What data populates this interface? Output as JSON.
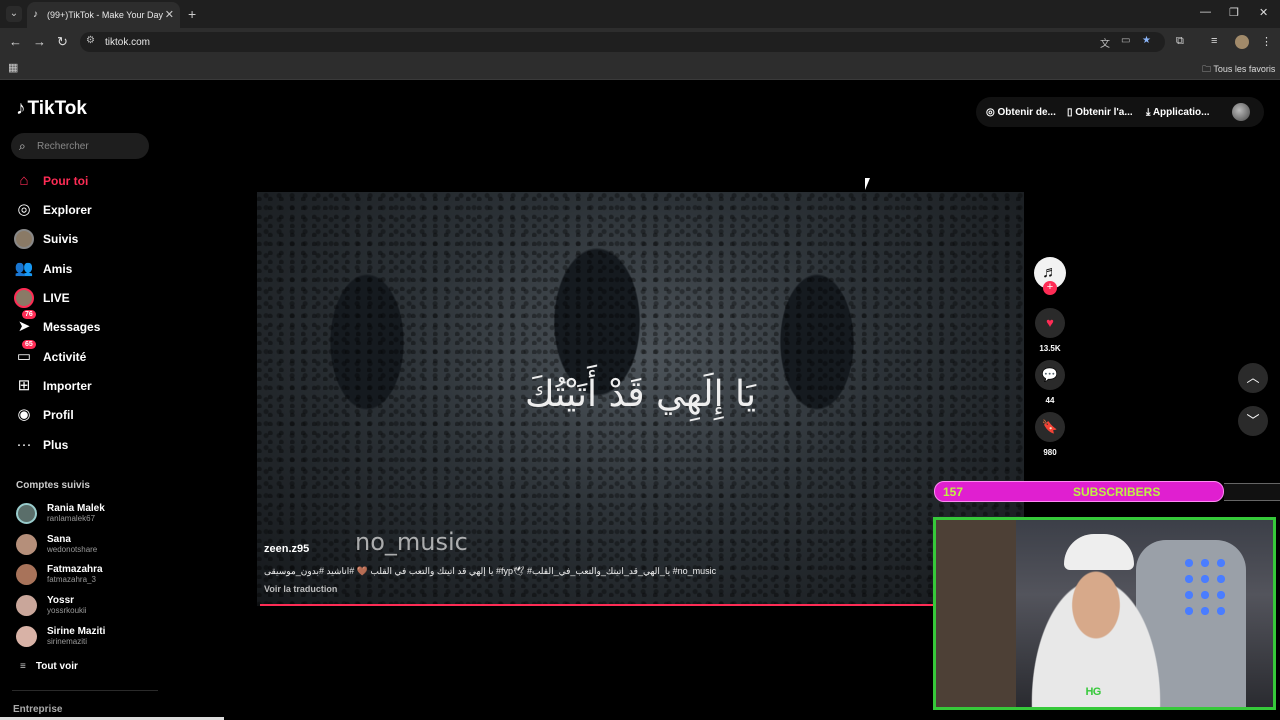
{
  "browser": {
    "tab_title": "(99+)TikTok - Make Your Day",
    "url": "tiktok.com",
    "bookmarks_all": "Tous les favoris"
  },
  "app": {
    "logo": "TikTok",
    "search_placeholder": "Rechercher",
    "nav": [
      {
        "label": "Pour toi",
        "icon": "home-icon",
        "active": true
      },
      {
        "label": "Explorer",
        "icon": "compass-icon"
      },
      {
        "label": "Suivis",
        "icon": "avatar-icon"
      },
      {
        "label": "Amis",
        "icon": "friends-icon"
      },
      {
        "label": "LIVE",
        "icon": "live-icon"
      },
      {
        "label": "Messages",
        "icon": "send-icon",
        "badge": "76"
      },
      {
        "label": "Activité",
        "icon": "inbox-icon",
        "badge": "65"
      },
      {
        "label": "Importer",
        "icon": "upload-icon"
      },
      {
        "label": "Profil",
        "icon": "profile-icon"
      },
      {
        "label": "Plus",
        "icon": "more-icon"
      }
    ],
    "followed_title": "Comptes suivis",
    "followed": [
      {
        "name": "Rania Malek",
        "handle": "ranlamalek67"
      },
      {
        "name": "Sana",
        "handle": "wedonotshare"
      },
      {
        "name": "Fatmazahra",
        "handle": "fatmazahra_3"
      },
      {
        "name": "Yossr",
        "handle": "yossrkoukii"
      },
      {
        "name": "Sirine Maziti",
        "handle": "sirinemaziti"
      }
    ],
    "see_all": "Tout voir",
    "footer_entreprise": "Entreprise",
    "top_actions": [
      "Obtenir de...",
      "Obtenir l'a...",
      "Applicatio..."
    ]
  },
  "video": {
    "overlay_text_arabic": "يَا إِلَهِي قَدْ أَتَيْتُكَ",
    "watermark": "no_music",
    "author": "zeen.z95",
    "caption": "يا إلهي قد اتيتك والتعب في القلب 🤎 #اناشيد #بدون_موسيقى #fyp🕊 #يا_الهي_قد_اتيتك_والتعب_في_القلب #no_music",
    "translate": "Voir la traduction",
    "progress": 0.88,
    "likes": "13.5K",
    "comments": "44",
    "saves": "980"
  },
  "stream_overlay": {
    "subs_count": "157",
    "subs_label": "SUBSCRIBERS",
    "subs_progress": 0.86
  }
}
